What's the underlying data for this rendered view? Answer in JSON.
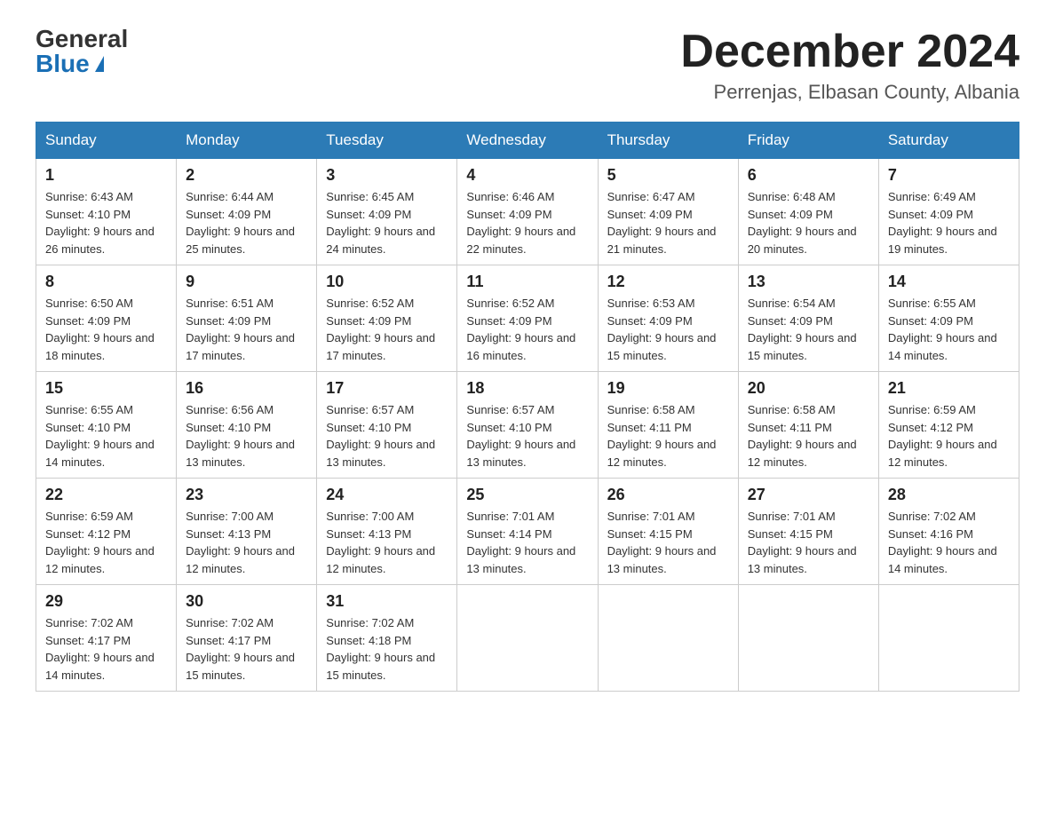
{
  "logo": {
    "general": "General",
    "blue": "Blue"
  },
  "title": "December 2024",
  "subtitle": "Perrenjas, Elbasan County, Albania",
  "days_of_week": [
    "Sunday",
    "Monday",
    "Tuesday",
    "Wednesday",
    "Thursday",
    "Friday",
    "Saturday"
  ],
  "weeks": [
    [
      {
        "num": "1",
        "sunrise": "6:43 AM",
        "sunset": "4:10 PM",
        "daylight": "9 hours and 26 minutes."
      },
      {
        "num": "2",
        "sunrise": "6:44 AM",
        "sunset": "4:09 PM",
        "daylight": "9 hours and 25 minutes."
      },
      {
        "num": "3",
        "sunrise": "6:45 AM",
        "sunset": "4:09 PM",
        "daylight": "9 hours and 24 minutes."
      },
      {
        "num": "4",
        "sunrise": "6:46 AM",
        "sunset": "4:09 PM",
        "daylight": "9 hours and 22 minutes."
      },
      {
        "num": "5",
        "sunrise": "6:47 AM",
        "sunset": "4:09 PM",
        "daylight": "9 hours and 21 minutes."
      },
      {
        "num": "6",
        "sunrise": "6:48 AM",
        "sunset": "4:09 PM",
        "daylight": "9 hours and 20 minutes."
      },
      {
        "num": "7",
        "sunrise": "6:49 AM",
        "sunset": "4:09 PM",
        "daylight": "9 hours and 19 minutes."
      }
    ],
    [
      {
        "num": "8",
        "sunrise": "6:50 AM",
        "sunset": "4:09 PM",
        "daylight": "9 hours and 18 minutes."
      },
      {
        "num": "9",
        "sunrise": "6:51 AM",
        "sunset": "4:09 PM",
        "daylight": "9 hours and 17 minutes."
      },
      {
        "num": "10",
        "sunrise": "6:52 AM",
        "sunset": "4:09 PM",
        "daylight": "9 hours and 17 minutes."
      },
      {
        "num": "11",
        "sunrise": "6:52 AM",
        "sunset": "4:09 PM",
        "daylight": "9 hours and 16 minutes."
      },
      {
        "num": "12",
        "sunrise": "6:53 AM",
        "sunset": "4:09 PM",
        "daylight": "9 hours and 15 minutes."
      },
      {
        "num": "13",
        "sunrise": "6:54 AM",
        "sunset": "4:09 PM",
        "daylight": "9 hours and 15 minutes."
      },
      {
        "num": "14",
        "sunrise": "6:55 AM",
        "sunset": "4:09 PM",
        "daylight": "9 hours and 14 minutes."
      }
    ],
    [
      {
        "num": "15",
        "sunrise": "6:55 AM",
        "sunset": "4:10 PM",
        "daylight": "9 hours and 14 minutes."
      },
      {
        "num": "16",
        "sunrise": "6:56 AM",
        "sunset": "4:10 PM",
        "daylight": "9 hours and 13 minutes."
      },
      {
        "num": "17",
        "sunrise": "6:57 AM",
        "sunset": "4:10 PM",
        "daylight": "9 hours and 13 minutes."
      },
      {
        "num": "18",
        "sunrise": "6:57 AM",
        "sunset": "4:10 PM",
        "daylight": "9 hours and 13 minutes."
      },
      {
        "num": "19",
        "sunrise": "6:58 AM",
        "sunset": "4:11 PM",
        "daylight": "9 hours and 12 minutes."
      },
      {
        "num": "20",
        "sunrise": "6:58 AM",
        "sunset": "4:11 PM",
        "daylight": "9 hours and 12 minutes."
      },
      {
        "num": "21",
        "sunrise": "6:59 AM",
        "sunset": "4:12 PM",
        "daylight": "9 hours and 12 minutes."
      }
    ],
    [
      {
        "num": "22",
        "sunrise": "6:59 AM",
        "sunset": "4:12 PM",
        "daylight": "9 hours and 12 minutes."
      },
      {
        "num": "23",
        "sunrise": "7:00 AM",
        "sunset": "4:13 PM",
        "daylight": "9 hours and 12 minutes."
      },
      {
        "num": "24",
        "sunrise": "7:00 AM",
        "sunset": "4:13 PM",
        "daylight": "9 hours and 12 minutes."
      },
      {
        "num": "25",
        "sunrise": "7:01 AM",
        "sunset": "4:14 PM",
        "daylight": "9 hours and 13 minutes."
      },
      {
        "num": "26",
        "sunrise": "7:01 AM",
        "sunset": "4:15 PM",
        "daylight": "9 hours and 13 minutes."
      },
      {
        "num": "27",
        "sunrise": "7:01 AM",
        "sunset": "4:15 PM",
        "daylight": "9 hours and 13 minutes."
      },
      {
        "num": "28",
        "sunrise": "7:02 AM",
        "sunset": "4:16 PM",
        "daylight": "9 hours and 14 minutes."
      }
    ],
    [
      {
        "num": "29",
        "sunrise": "7:02 AM",
        "sunset": "4:17 PM",
        "daylight": "9 hours and 14 minutes."
      },
      {
        "num": "30",
        "sunrise": "7:02 AM",
        "sunset": "4:17 PM",
        "daylight": "9 hours and 15 minutes."
      },
      {
        "num": "31",
        "sunrise": "7:02 AM",
        "sunset": "4:18 PM",
        "daylight": "9 hours and 15 minutes."
      },
      null,
      null,
      null,
      null
    ]
  ]
}
